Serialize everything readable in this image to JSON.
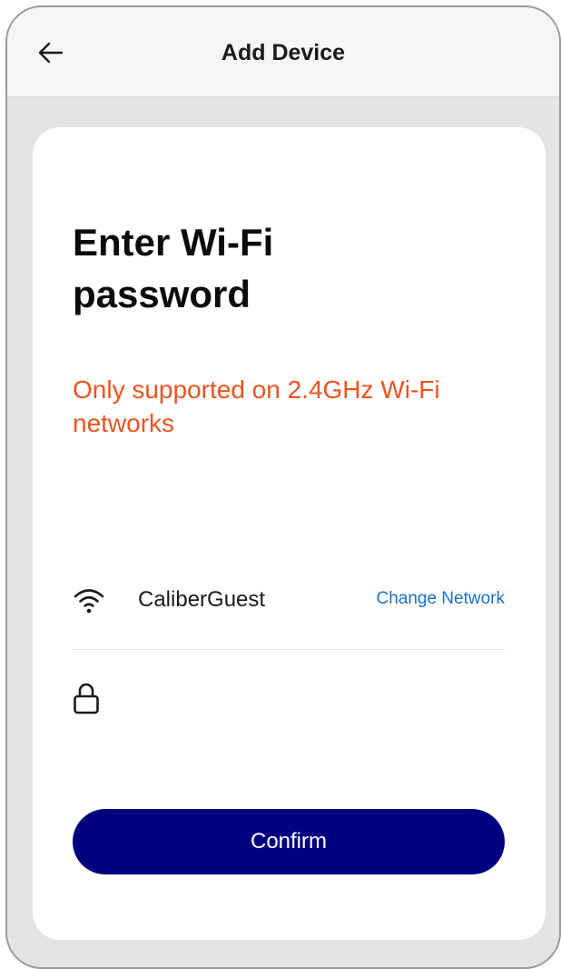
{
  "header": {
    "title": "Add Device",
    "back_icon": "arrow-left-icon"
  },
  "card": {
    "title": "Enter Wi-Fi password",
    "warning": "Only supported on 2.4GHz Wi-Fi networks",
    "warning_color": "#f0521e"
  },
  "network": {
    "icon": "wifi-icon",
    "name": "CaliberGuest",
    "change_label": "Change Network",
    "link_color": "#1a6fc7"
  },
  "password": {
    "icon": "lock-icon",
    "value": "",
    "placeholder": ""
  },
  "confirm": {
    "label": "Confirm",
    "color": "#03007f"
  }
}
